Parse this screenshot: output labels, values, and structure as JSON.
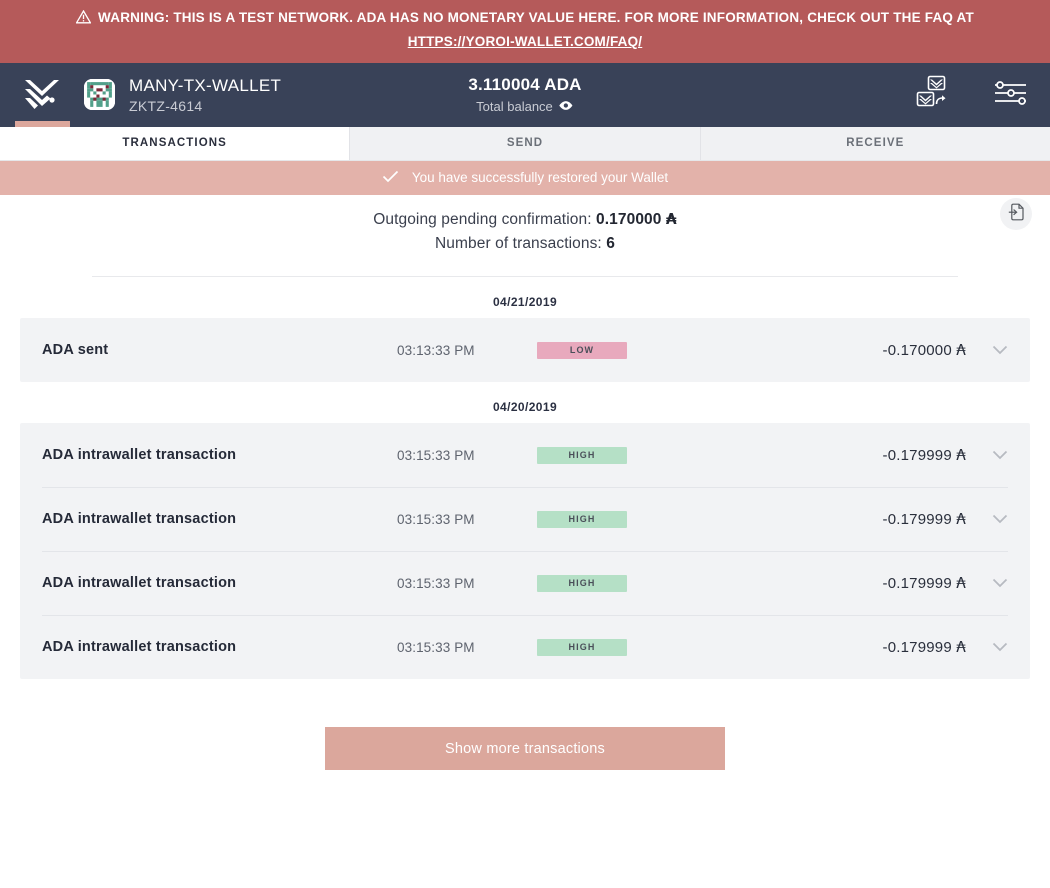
{
  "warning": {
    "icon": "warning-triangle-icon",
    "text": "WARNING: THIS IS A TEST NETWORK. ADA HAS NO MONETARY VALUE HERE. FOR MORE INFORMATION, CHECK OUT THE FAQ AT",
    "link": "HTTPS://YOROI-WALLET.COM/FAQ/",
    "background": "#b55a5a"
  },
  "topbar": {
    "logo": "yoroi-logo-icon",
    "wallet_name": "MANY-TX-WALLET",
    "wallet_id": "ZKTZ-4614",
    "balance_amount": "3.110004 ADA",
    "balance_label": "Total balance",
    "eye_icon": "eye-icon",
    "switch_wallet_icon": "switch-wallet-icon",
    "settings_icon": "settings-sliders-icon",
    "background": "#394258"
  },
  "tabs": [
    {
      "label": "TRANSACTIONS",
      "active": true
    },
    {
      "label": "SEND",
      "active": false
    },
    {
      "label": "RECEIVE",
      "active": false
    }
  ],
  "notification": {
    "icon": "check-icon",
    "text": "You have successfully restored your Wallet",
    "background": "#e3b2aa"
  },
  "summary": {
    "pending_label": "Outgoing pending confirmation:",
    "pending_value": "0.170000",
    "pending_symbol": "₳",
    "count_label": "Number of transactions:",
    "count_value": "6",
    "export_icon": "export-transactions-icon"
  },
  "groups": [
    {
      "date": "04/21/2019",
      "rows": [
        {
          "type": "ADA sent",
          "time": "03:13:33 PM",
          "status": "LOW",
          "status_class": "low",
          "status_color": "#e8a9bd",
          "amount": "-0.170000",
          "symbol": "₳",
          "chevron": "chevron-down-icon"
        }
      ]
    },
    {
      "date": "04/20/2019",
      "rows": [
        {
          "type": "ADA intrawallet transaction",
          "time": "03:15:33 PM",
          "status": "HIGH",
          "status_class": "high",
          "status_color": "#b5e0c6",
          "amount": "-0.179999",
          "symbol": "₳",
          "chevron": "chevron-down-icon"
        },
        {
          "type": "ADA intrawallet transaction",
          "time": "03:15:33 PM",
          "status": "HIGH",
          "status_class": "high",
          "status_color": "#b5e0c6",
          "amount": "-0.179999",
          "symbol": "₳",
          "chevron": "chevron-down-icon"
        },
        {
          "type": "ADA intrawallet transaction",
          "time": "03:15:33 PM",
          "status": "HIGH",
          "status_class": "high",
          "status_color": "#b5e0c6",
          "amount": "-0.179999",
          "symbol": "₳",
          "chevron": "chevron-down-icon"
        },
        {
          "type": "ADA intrawallet transaction",
          "time": "03:15:33 PM",
          "status": "HIGH",
          "status_class": "high",
          "status_color": "#b5e0c6",
          "amount": "-0.179999",
          "symbol": "₳",
          "chevron": "chevron-down-icon"
        }
      ]
    }
  ],
  "show_more": {
    "label": "Show more transactions",
    "background": "#dba79c"
  }
}
